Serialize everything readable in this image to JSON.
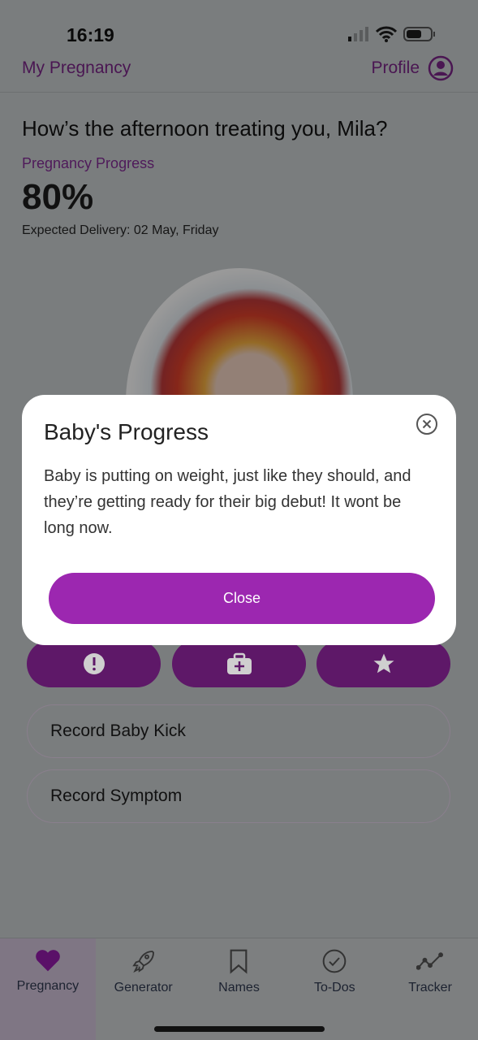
{
  "status_bar": {
    "time": "16:19"
  },
  "nav": {
    "title": "My Pregnancy",
    "profile_label": "Profile"
  },
  "main": {
    "greeting": "How’s the afternoon treating you, Mila?",
    "progress_label": "Pregnancy Progress",
    "progress_value": "80%",
    "expected_delivery": "Expected Delivery: 02 May, Friday",
    "action_icons": [
      "alert-icon",
      "first-aid-icon",
      "star-icon"
    ],
    "record_buttons": [
      "Record Baby Kick",
      "Record Symptom"
    ]
  },
  "modal": {
    "title": "Baby's Progress",
    "body": "Baby is putting on weight, just like they should, and they’re getting ready for their big debut! It wont be long now.",
    "close_label": "Close"
  },
  "tabs": [
    {
      "label": "Pregnancy",
      "icon": "heart-icon"
    },
    {
      "label": "Generator",
      "icon": "rocket-icon"
    },
    {
      "label": "Names",
      "icon": "bookmark-icon"
    },
    {
      "label": "To-Dos",
      "icon": "check-circle-icon"
    },
    {
      "label": "Tracker",
      "icon": "trend-icon"
    }
  ],
  "colors": {
    "accent": "#9c27b0",
    "dark_accent": "#7a1a8a",
    "overlay": "rgba(0,0,0,0.52)"
  }
}
